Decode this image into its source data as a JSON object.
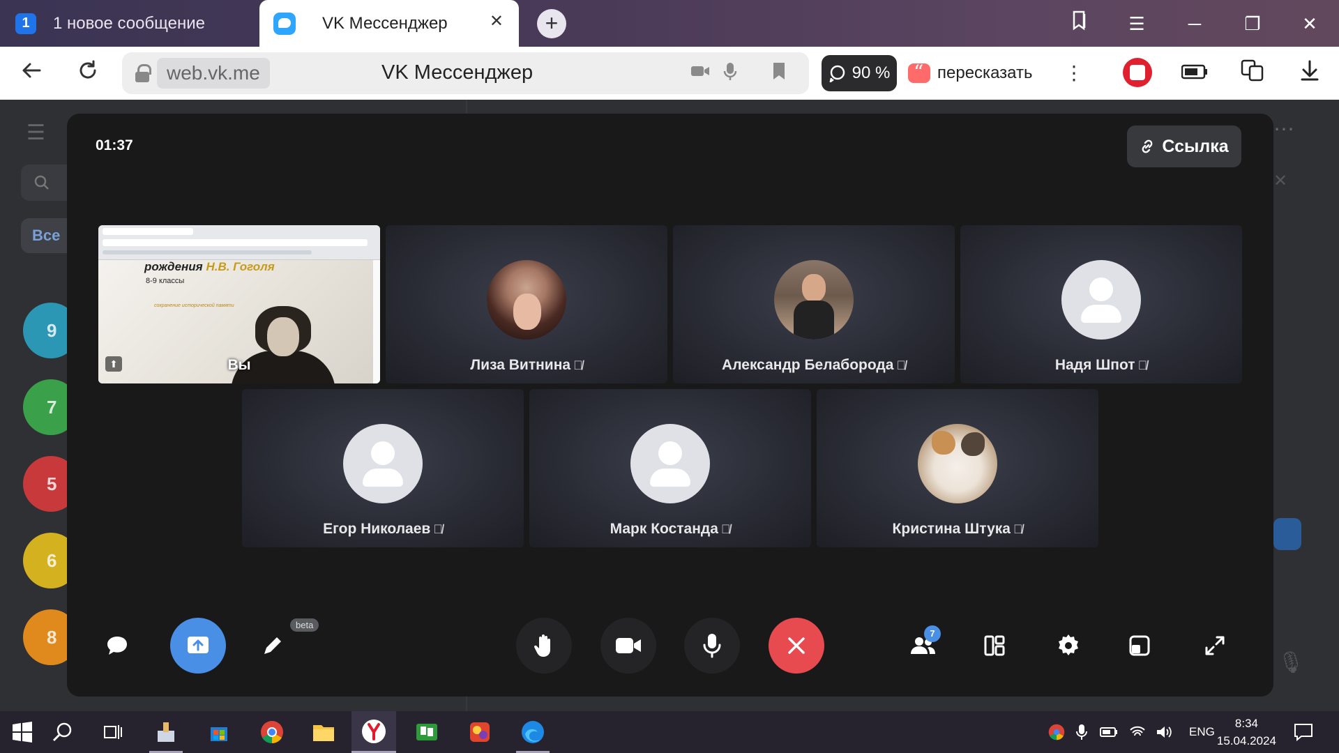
{
  "browser": {
    "inactive_tab": {
      "badge": "1",
      "title": "1 новое сообщение"
    },
    "active_tab": {
      "title": "VK Мессенджер"
    },
    "address": {
      "domain": "web.vk.me",
      "page_title": "VK Мессенджер"
    },
    "zoom": "90 %",
    "retell_label": "пересказать"
  },
  "vk_background": {
    "filter_chip": "Все",
    "badges": [
      "9",
      "7",
      "5",
      "6",
      "8"
    ],
    "badge_colors": [
      "#2c97b4",
      "#3aa14a",
      "#c8393c",
      "#d4b11f",
      "#e08a1e"
    ]
  },
  "call": {
    "timer": "01:37",
    "link_button": "Ссылка",
    "self_tile": {
      "label": "Вы",
      "slide_title_prefix": "рождения",
      "slide_title_name": "Н.В. Гоголя",
      "slide_subtitle": "8-9 классы",
      "slide_note": "сохранение исторической памяти"
    },
    "participants": [
      {
        "name": "Лиза Витнина",
        "avatar": "photo-girl"
      },
      {
        "name": "Александр Белаборода",
        "avatar": "photo-man"
      },
      {
        "name": "Надя Шпот",
        "avatar": "placeholder"
      },
      {
        "name": "Егор Николаев",
        "avatar": "placeholder"
      },
      {
        "name": "Марк Костанда",
        "avatar": "placeholder"
      },
      {
        "name": "Кристина Штука",
        "avatar": "photo-cat"
      }
    ],
    "controls": {
      "beta_label": "beta",
      "participants_count": "7",
      "accent_color": "#4a8fe6",
      "end_call_color": "#e84b4f"
    }
  },
  "taskbar": {
    "language": "ENG",
    "time": "8:34",
    "date": "15.04.2024"
  }
}
